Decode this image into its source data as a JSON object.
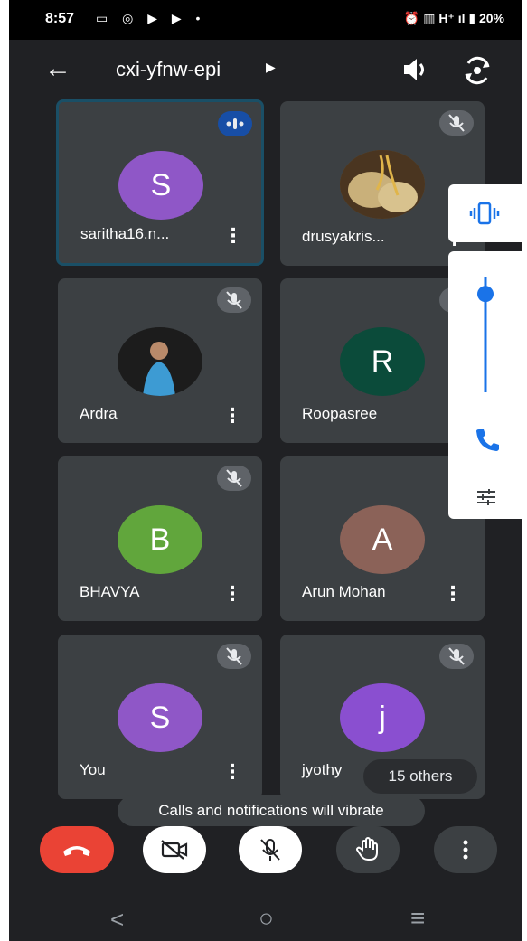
{
  "status_bar": {
    "time": "8:57",
    "left_icons": "▭ ◎ ▶ ▶ •",
    "right_text": "⏰ ▥ H⁺ ıl ▮ 20%"
  },
  "topbar": {
    "title": "cxi-yfnw-epi",
    "title_caret": "▶",
    "back_label": "←"
  },
  "tiles": [
    {
      "name": "saritha16.n...",
      "initial": "S",
      "color": "#8f57c7"
    },
    {
      "name": "drusyakris...",
      "photo": "locket-photo"
    },
    {
      "name": "Ardra",
      "photo": "person-photo"
    },
    {
      "name": "Roopasree",
      "initial": "R",
      "color": "#0b4b3a"
    },
    {
      "name": "BHAVYA",
      "initial": "B",
      "color": "#61a63c"
    },
    {
      "name": "Arun Mohan",
      "initial": "A",
      "color": "#8b6258"
    },
    {
      "name": "You",
      "initial": "S",
      "color": "#8f57c7"
    },
    {
      "name": "jyothy",
      "initial": "j",
      "color": "#8a4fd0"
    }
  ],
  "kebab_glyph": "⋮",
  "others_label": "15 others",
  "toast": "Calls and notifications will vibrate",
  "colors": {
    "accent": "#1a73e8",
    "end_call": "#ea4335",
    "tile_bg": "#3c4043",
    "background": "#202124"
  },
  "volume": {
    "level": 0.85
  },
  "nav": {
    "back": "<",
    "home": "○",
    "recents": "≡"
  },
  "icons": {
    "back": "arrow-left-icon",
    "speaker": "speaker-icon",
    "flip": "flip-camera-icon",
    "mute": "mic-off-icon",
    "speaking": "speaking-dots-icon",
    "vibrate": "vibrate-icon",
    "phone": "phone-icon",
    "settings": "tune-icon",
    "end_call": "end-call-icon",
    "camera_off": "camera-off-icon",
    "raise_hand": "hand-icon",
    "more": "more-vert-icon"
  }
}
